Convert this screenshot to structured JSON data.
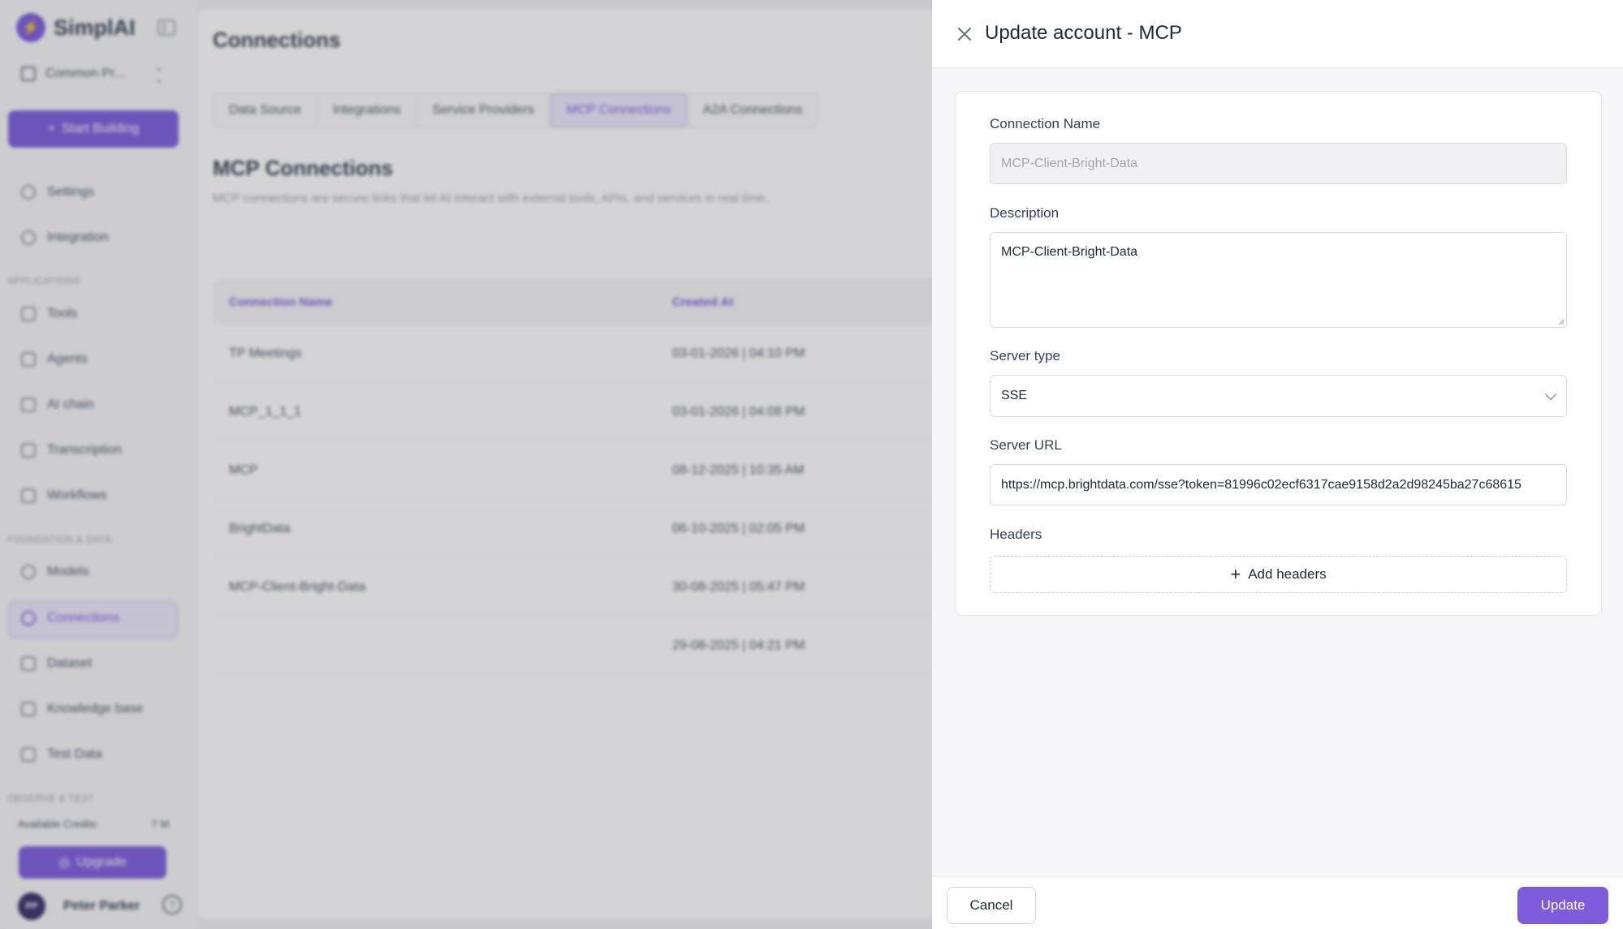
{
  "app": {
    "brand": "SimplAI",
    "project": "Common Pr...",
    "start_building": "Start Building",
    "nav": {
      "settings": "Settings",
      "integration": "Integration",
      "section_applications": "APPLICATIONS",
      "tools": "Tools",
      "agents": "Agents",
      "ai_chain": "AI chain",
      "transcription": "Transcription",
      "workflows": "Workflows",
      "section_foundation": "FOUNDATION & DATA",
      "models": "Models",
      "connections": "Connections",
      "dataset": "Dataset",
      "knowledge_base": "Knowledge base",
      "test_data": "Test Data",
      "section_observe": "OBSERVE & TEST"
    },
    "credits_label": "Available Credits",
    "credits_value": "7 M",
    "upgrade": "Upgrade",
    "user_initials": "PP",
    "user_name": "Peter Parker"
  },
  "main": {
    "title": "Connections",
    "tabs": [
      "Data Source",
      "Integrations",
      "Service Providers",
      "MCP Connections",
      "A2A Connections"
    ],
    "active_tab": "MCP Connections",
    "section_title": "MCP Connections",
    "section_desc": "MCP connections are secure links that let AI interact with external tools, APIs, and services in real time.",
    "table": {
      "headers": [
        "Connection Name",
        "Created At"
      ],
      "rows": [
        [
          "TP Meetings",
          "03-01-2026 | 04:10 PM"
        ],
        [
          "MCP_1_1_1",
          "03-01-2026 | 04:08 PM"
        ],
        [
          "MCP",
          "08-12-2025 | 10:35 AM"
        ],
        [
          "BrightData",
          "06-10-2025 | 02:05 PM"
        ],
        [
          "MCP-Client-Bright-Data",
          "30-08-2025 | 05:47 PM"
        ],
        [
          "",
          "29-08-2025 | 04:21 PM"
        ]
      ]
    }
  },
  "drawer": {
    "title": "Update account - MCP",
    "connection_name_label": "Connection Name",
    "connection_name_value": "MCP-Client-Bright-Data",
    "description_label": "Description",
    "description_value": "MCP-Client-Bright-Data",
    "server_type_label": "Server type",
    "server_type_value": "SSE",
    "server_url_label": "Server URL",
    "server_url_value": "https://mcp.brightdata.com/sse?token=81996c02ecf6317cae9158d2a2d98245ba27c68615",
    "headers_label": "Headers",
    "add_headers": "Add headers",
    "cancel": "Cancel",
    "update": "Update"
  },
  "colors": {
    "accent": "#7c5cdb",
    "accent_soft": "#ece8fb"
  }
}
